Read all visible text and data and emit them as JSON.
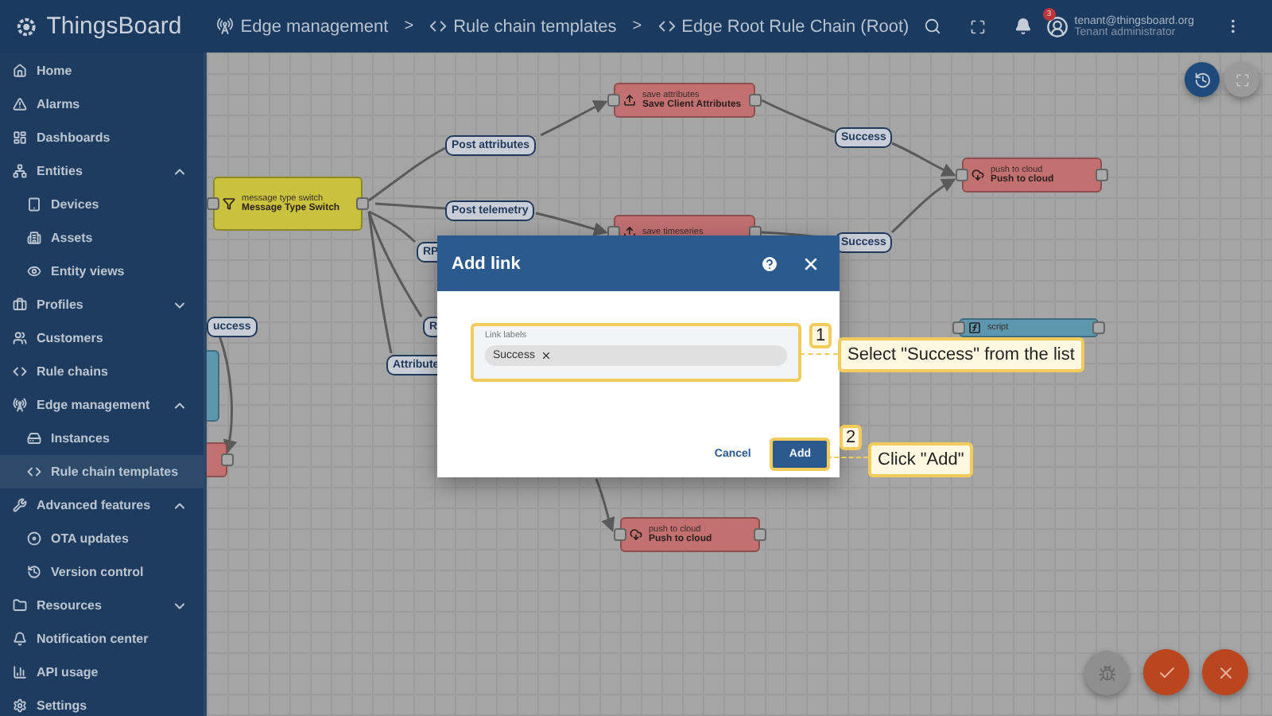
{
  "header": {
    "logo_text": "ThingsBoard",
    "breadcrumbs": [
      {
        "label": "Edge management",
        "separator": ">"
      },
      {
        "label": "Rule chain templates",
        "separator": ">"
      },
      {
        "label": "Edge Root Rule Chain (Root)"
      }
    ],
    "notification_count": "3",
    "user": {
      "email": "tenant@thingsboard.org",
      "role": "Tenant administrator"
    }
  },
  "sidebar": {
    "items": [
      {
        "label": "Home",
        "selected": false
      },
      {
        "label": "Alarms",
        "selected": false
      },
      {
        "label": "Dashboards",
        "selected": false
      },
      {
        "label": "Entities",
        "selected": false,
        "expanded": true,
        "children": [
          {
            "label": "Devices",
            "selected": false
          },
          {
            "label": "Assets",
            "selected": false
          },
          {
            "label": "Entity views",
            "selected": false
          }
        ]
      },
      {
        "label": "Profiles",
        "selected": false,
        "expanded": false
      },
      {
        "label": "Customers",
        "selected": false
      },
      {
        "label": "Rule chains",
        "selected": false
      },
      {
        "label": "Edge management",
        "selected": false,
        "expanded": true,
        "children": [
          {
            "label": "Instances",
            "selected": false
          },
          {
            "label": "Rule chain templates",
            "selected": true
          }
        ]
      },
      {
        "label": "Advanced features",
        "selected": false,
        "expanded": true,
        "children": [
          {
            "label": "OTA updates",
            "selected": false
          },
          {
            "label": "Version control",
            "selected": false
          }
        ]
      },
      {
        "label": "Resources",
        "selected": false,
        "expanded": false
      },
      {
        "label": "Notification center",
        "selected": false
      },
      {
        "label": "API usage",
        "selected": false
      },
      {
        "label": "Settings",
        "selected": false
      }
    ]
  },
  "canvas": {
    "nodes": [
      {
        "kind": "filter",
        "type": "message type switch",
        "name": "Message Type Switch"
      },
      {
        "kind": "action",
        "type": "save attributes",
        "name": "Save Client Attributes"
      },
      {
        "kind": "action",
        "type": "save timeseries"
      },
      {
        "kind": "action",
        "type": "push to cloud",
        "name": "Push to cloud"
      },
      {
        "kind": "action",
        "type": "push to cloud",
        "name": "Push to cloud"
      },
      {
        "kind": "transform",
        "type": "script"
      },
      {
        "kind": "action"
      },
      {
        "kind": "transform"
      }
    ],
    "link_labels": [
      "Post attributes",
      "Post telemetry",
      "Success",
      "Success",
      "RP",
      "R",
      "Attribute",
      "uccess"
    ]
  },
  "dialog": {
    "title": "Add link",
    "field": {
      "label": "Link labels",
      "chips": [
        "Success"
      ]
    },
    "buttons": [
      {
        "label": "Cancel",
        "kind": "text",
        "highlighted": false
      },
      {
        "label": "Add",
        "kind": "primary",
        "highlighted": true
      }
    ]
  },
  "callouts": [
    {
      "number": "1",
      "text": "Select \"Success\" from the list"
    },
    {
      "number": "2",
      "text": "Click \"Add\""
    }
  ]
}
